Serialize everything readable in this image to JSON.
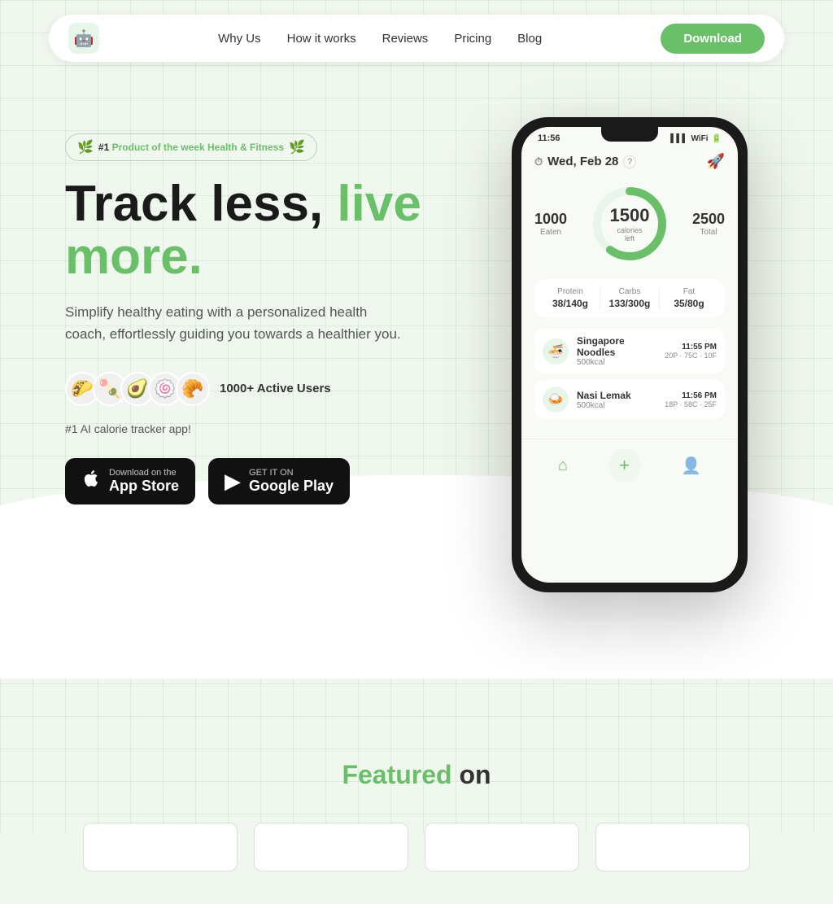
{
  "nav": {
    "logo_emoji": "🤖",
    "links": [
      {
        "id": "why-us",
        "label": "Why Us"
      },
      {
        "id": "how-it-works",
        "label": "How it works"
      },
      {
        "id": "reviews",
        "label": "Reviews"
      },
      {
        "id": "pricing",
        "label": "Pricing"
      },
      {
        "id": "blog",
        "label": "Blog"
      }
    ],
    "download_label": "Download"
  },
  "hero": {
    "badge": {
      "number": "#1",
      "text": "Product of the week",
      "category": "Health & Fitness"
    },
    "headline_black": "Track less,",
    "headline_green": " live more.",
    "subtext": "Simplify healthy eating with a personalized health coach, effortlessly guiding you towards a healthier you.",
    "users_count": "1000+ Active Users",
    "ai_label": "#1 AI calorie tracker app!",
    "avatars": [
      "🌮",
      "🍡",
      "🥑",
      "🍥",
      "🥐"
    ],
    "app_store_btn": {
      "top": "Download on the",
      "main": "App Store",
      "icon": "🍎"
    },
    "google_play_btn": {
      "top": "GET IT ON",
      "main": "Google Play",
      "icon": "▶"
    }
  },
  "phone": {
    "time": "11:56",
    "date": "Wed, Feb 28",
    "calories_eaten": "1000",
    "calories_eaten_label": "Eaten",
    "calories_left": "1500",
    "calories_left_label": "calories\nleft",
    "calories_total": "2500",
    "calories_total_label": "Total",
    "ring_progress": 0.6,
    "macros": [
      {
        "name": "Protein",
        "value": "38/140g"
      },
      {
        "name": "Carbs",
        "value": "133/300g"
      },
      {
        "name": "Fat",
        "value": "35/80g"
      }
    ],
    "food_items": [
      {
        "name": "Singapore Noodles",
        "kcal": "500kcal",
        "time": "11:55 PM",
        "macros": "20P · 75C · 10F",
        "emoji": "🍜"
      },
      {
        "name": "Nasi Lemak",
        "kcal": "500kcal",
        "time": "11:56 PM",
        "macros": "18P · 58C · 25F",
        "emoji": "🍛"
      }
    ]
  },
  "featured": {
    "title_green": "Featured",
    "title_dark": " on",
    "logos": [
      "",
      "",
      "",
      ""
    ]
  }
}
